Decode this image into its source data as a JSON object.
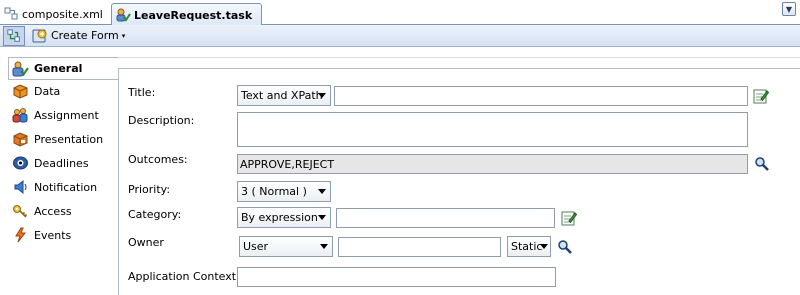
{
  "tabs": [
    {
      "label": "composite.xml",
      "icon": "composite-icon"
    },
    {
      "label": "LeaveRequest.task",
      "icon": "task-icon"
    }
  ],
  "toolbar": {
    "create_form_label": "Create Form",
    "caret": "▾"
  },
  "nav": [
    {
      "label": "General"
    },
    {
      "label": "Data"
    },
    {
      "label": "Assignment"
    },
    {
      "label": "Presentation"
    },
    {
      "label": "Deadlines"
    },
    {
      "label": "Notification"
    },
    {
      "label": "Access"
    },
    {
      "label": "Events"
    }
  ],
  "form": {
    "title_label": "Title:",
    "title_type": "Text and XPath",
    "title_value": "",
    "description_label": "Description:",
    "description_value": "",
    "outcomes_label": "Outcomes:",
    "outcomes_value": "APPROVE,REJECT",
    "priority_label": "Priority:",
    "priority_value": "3  ( Normal )",
    "category_label": "Category:",
    "category_type": "By expression",
    "category_value": "",
    "owner_label": "Owner",
    "owner_type": "User",
    "owner_value": "",
    "owner_mode": "Static",
    "app_context_label": "Application Context:",
    "app_context_value": ""
  }
}
